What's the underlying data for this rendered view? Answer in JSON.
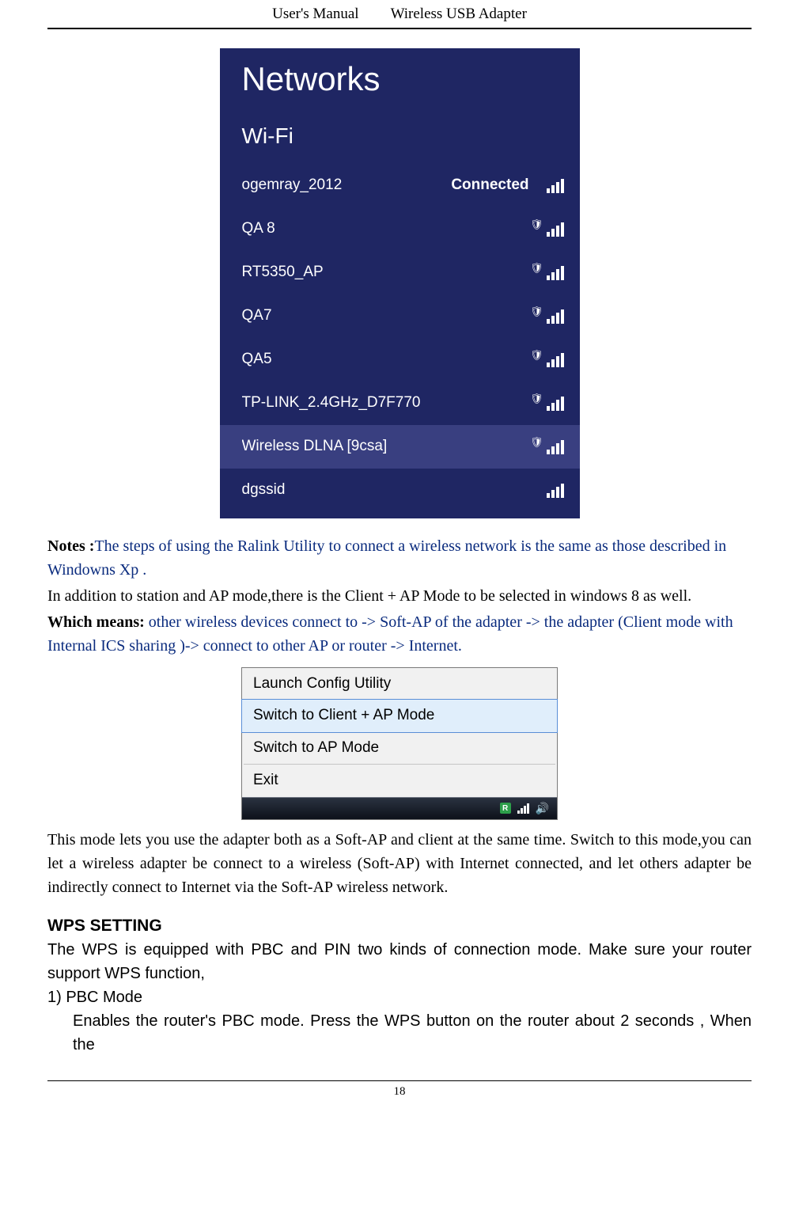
{
  "header": {
    "left": "User's Manual",
    "right": "Wireless USB Adapter"
  },
  "networks_panel": {
    "title": "Networks",
    "subtitle": "Wi-Fi",
    "connected_label": "Connected",
    "items": [
      {
        "name": "ogemray_2012",
        "connected": true,
        "secure": false,
        "bars": 4
      },
      {
        "name": "QA 8",
        "connected": false,
        "secure": true,
        "bars": 4
      },
      {
        "name": "RT5350_AP",
        "connected": false,
        "secure": true,
        "bars": 4
      },
      {
        "name": "QA7",
        "connected": false,
        "secure": true,
        "bars": 4
      },
      {
        "name": "QA5",
        "connected": false,
        "secure": true,
        "bars": 4
      },
      {
        "name": "TP-LINK_2.4GHz_D7F770",
        "connected": false,
        "secure": true,
        "bars": 4
      },
      {
        "name": "Wireless DLNA [9csa]",
        "connected": false,
        "secure": true,
        "bars": 4,
        "selected": true
      },
      {
        "name": "dgssid",
        "connected": false,
        "secure": false,
        "bars": 4
      }
    ]
  },
  "paragraphs": {
    "notes_label": "Notes :",
    "notes_text": "The steps of using the Ralink Utility to connect a wireless network is the same as those described in Windowns Xp .",
    "addition": "In addition to station and AP mode,there is the Client + AP Mode to be selected in windows 8 as well.",
    "which_label": "Which means:",
    "which_text": " other wireless devices connect to -> Soft-AP of the adapter -> the adapter (Client mode with Internal ICS sharing )-> connect to other AP or router -> Internet.",
    "after_menu": "This mode lets you use the adapter both as a Soft-AP and client   at the same time. Switch to this mode,you can let a wireless adapter be connect to a wireless (Soft-AP) with Internet connected, and let others adapter be indirectly connect to Internet via the Soft-AP wireless network.",
    "wps_heading": "WPS SETTING",
    "wps_p1": "The WPS is equipped with PBC and PIN two kinds of connection mode. Make sure your router support WPS function,",
    "wps_l1": "1) PBC Mode",
    "wps_l2": "Enables the router's PBC mode. Press the WPS button on the router about 2 seconds , When the"
  },
  "context_menu": {
    "items": [
      {
        "label": "Launch Config Utility",
        "highlight": false
      },
      {
        "label": "Switch to Client + AP Mode",
        "highlight": true
      },
      {
        "label": "Switch to AP Mode",
        "highlight": false
      },
      {
        "label": "Exit",
        "highlight": false
      }
    ]
  },
  "page_number": "18"
}
